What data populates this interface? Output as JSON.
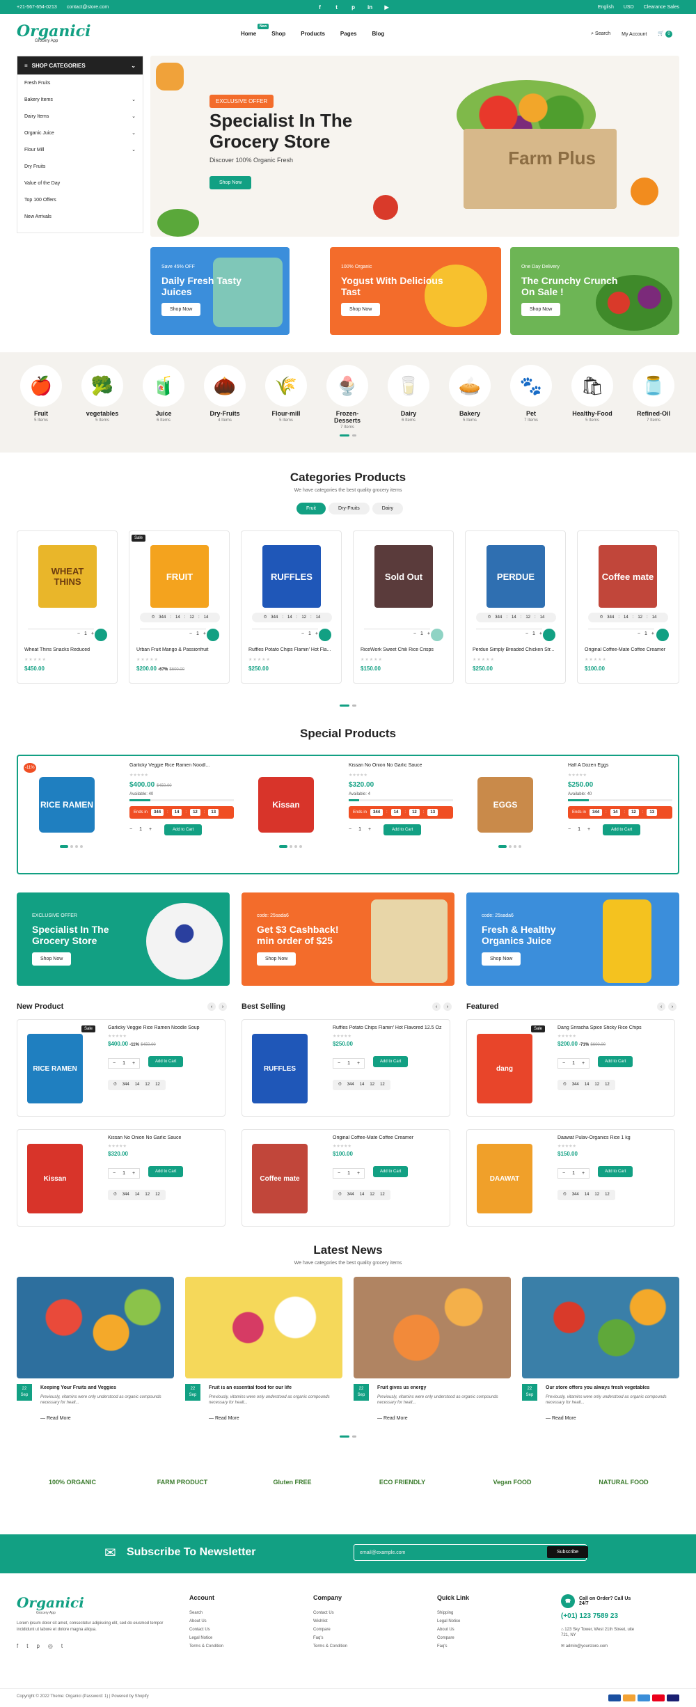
{
  "topbar": {
    "phone": "+21-567-654-0213",
    "email": "contact@store.com",
    "language": "English",
    "currency": "USD",
    "clearance": "Clearance Sales"
  },
  "header": {
    "logo": "Organici",
    "logo_sub": "Grocery App",
    "new_badge": "New",
    "search": "Search",
    "account": "My Account",
    "cart_count": "0"
  },
  "nav": [
    "Home",
    "Shop",
    "Products",
    "Pages",
    "Blog"
  ],
  "sidebar": {
    "title": "SHOP CATEGORIES",
    "items": [
      "Fresh Fruits",
      "Bakery Items",
      "Dairy Items",
      "Organic Juice",
      "Flour Mill",
      "Dry Fruits",
      "Value of the Day",
      "Top 100 Offers",
      "New Arrivals"
    ]
  },
  "hero": {
    "badge": "EXCLUSIVE OFFER",
    "title": "Specialist In The Grocery Store",
    "subtitle": "Discover 100% Organic Fresh",
    "button": "Shop Now",
    "crate": "Farm Plus"
  },
  "promos": [
    {
      "line1": "Save 45% OFF",
      "line2": "Daily Fresh Tasty Juices",
      "button": "Shop Now"
    },
    {
      "line1": "100% Organic",
      "line2": "Yogust With Delicious Tast",
      "button": "Shop Now"
    },
    {
      "line1": "One Day Delivery",
      "line2": "The Crunchy Crunch On Sale !",
      "button": "Shop Now"
    }
  ],
  "categories": [
    {
      "name": "Fruit",
      "count": "5 Items"
    },
    {
      "name": "vegetables",
      "count": "5 Items"
    },
    {
      "name": "Juice",
      "count": "6 Items"
    },
    {
      "name": "Dry-Fruits",
      "count": "4 Items"
    },
    {
      "name": "Flour-mill",
      "count": "5 Items"
    },
    {
      "name": "Frozen-Desserts",
      "count": "7 Items"
    },
    {
      "name": "Dairy",
      "count": "6 Items"
    },
    {
      "name": "Bakery",
      "count": "5 Items"
    },
    {
      "name": "Pet",
      "count": "7 Items"
    },
    {
      "name": "Healthy-Food",
      "count": "5 Items"
    },
    {
      "name": "Refined-Oil",
      "count": "7 Items"
    }
  ],
  "cat_products": {
    "title": "Categories Products",
    "subtitle": "We have categories the best quality grocery items",
    "tabs": [
      "Fruit",
      "Dry-Fruits",
      "Dairy"
    ],
    "items": [
      {
        "name": "Wheat Thins Snacks Reduced",
        "price": "$450.00",
        "old": "",
        "off": "",
        "img": "WHEAT THINS",
        "sale": ""
      },
      {
        "name": "Urban Fruit Mango & Passionfruit",
        "price": "$200.00",
        "old": "$600.00",
        "off": "-67%",
        "img": "FRUIT",
        "sale": "Sale"
      },
      {
        "name": "Ruffles Potato Chips Flamin' Hot Fla...",
        "price": "$250.00",
        "old": "",
        "off": "",
        "img": "RUFFLES",
        "sale": ""
      },
      {
        "name": "RiceWork Sweet Chili Rice Crisps",
        "price": "$150.00",
        "old": "",
        "off": "",
        "img": "Sold Out",
        "sale": ""
      },
      {
        "name": "Perdue Simply Breaded Chicken Str...",
        "price": "$250.00",
        "old": "",
        "off": "",
        "img": "PERDUE",
        "sale": ""
      },
      {
        "name": "Original Coffee-Mate Coffee Creamer",
        "price": "$100.00",
        "old": "",
        "off": "",
        "img": "Coffee mate",
        "sale": ""
      }
    ],
    "timer": [
      "344",
      "14",
      "12",
      "14"
    ]
  },
  "special": {
    "title": "Special Products",
    "items": [
      {
        "name": "Garlicky Veggie Rice Ramen Noodl...",
        "price": "$400.00",
        "old": "$450.00",
        "available": "Available: 40",
        "badge": "-11%",
        "img": "RICE RAMEN"
      },
      {
        "name": "Kissan No Onion No Garlic Sauce",
        "price": "$320.00",
        "old": "",
        "available": "Available: 4",
        "badge": "",
        "img": "Kissan"
      },
      {
        "name": "Half A Dozen Eggs",
        "price": "$250.00",
        "old": "",
        "available": "Available: 40",
        "badge": "",
        "img": "EGGS"
      }
    ],
    "ends": "Ends in",
    "timer": [
      "344",
      "14",
      "12",
      "13"
    ],
    "add": "Add to Cart",
    "qty": "1"
  },
  "banners": [
    {
      "line1": "EXCLUSIVE OFFER",
      "line2": "Specialist In The Grocery Store",
      "button": "Shop Now"
    },
    {
      "line1": "code: 25sada6",
      "line2": "Get $3 Cashback! min order of $25",
      "button": "Shop Now"
    },
    {
      "line1": "code: 25sada6",
      "line2": "Fresh & Healthy Organics Juice",
      "button": "Shop Now"
    }
  ],
  "columns": [
    {
      "title": "New Product",
      "items": [
        {
          "name": "Garlicky Veggie Rice Ramen Noodle Soup",
          "price": "$400.00",
          "old": "$450.00",
          "off": "-11%",
          "sale": "Sale",
          "img": "RICE RAMEN"
        },
        {
          "name": "Kissan No Onion No Garlic Sauce",
          "price": "$320.00",
          "old": "",
          "off": "",
          "sale": "",
          "img": "Kissan"
        }
      ]
    },
    {
      "title": "Best Selling",
      "items": [
        {
          "name": "Ruffles Potato Chips Flamin' Hot Flavored 12.5 Oz",
          "price": "$250.00",
          "old": "",
          "off": "",
          "sale": "",
          "img": "RUFFLES"
        },
        {
          "name": "Original Coffee-Mate Coffee Creamer",
          "price": "$100.00",
          "old": "",
          "off": "",
          "sale": "",
          "img": "Coffee mate"
        }
      ]
    },
    {
      "title": "Featured",
      "items": [
        {
          "name": "Dang Sriracha Spice Sticky Rice Chips",
          "price": "$200.00",
          "old": "$600.00",
          "off": "-71%",
          "sale": "Sale",
          "img": "dang"
        },
        {
          "name": "Daawat Pulav-Organics Rice 1 kg",
          "price": "$150.00",
          "old": "",
          "off": "",
          "sale": "",
          "img": "DAAWAT"
        }
      ]
    }
  ],
  "mini_timer": [
    "344",
    "14",
    "12",
    "12"
  ],
  "news": {
    "title": "Latest News",
    "subtitle": "We have categories the best quality grocery items",
    "items": [
      {
        "day": "22",
        "mon": "Sep",
        "title": "Keeping Your Fruits and Veggies",
        "text": "Previously, vitamins were only understood as organic compounds necessary for healt...",
        "more": "Read More"
      },
      {
        "day": "22",
        "mon": "Sep",
        "title": "Fruit is an essential food for our life",
        "text": "Previously, vitamins were only understood as organic compounds necessary for healt...",
        "more": "Read More"
      },
      {
        "day": "22",
        "mon": "Sep",
        "title": "Fruit gives us energy",
        "text": "Previously, vitamins were only understood as organic compounds necessary for healt...",
        "more": "Read More"
      },
      {
        "day": "22",
        "mon": "Sep",
        "title": "Our store offers you always fresh vegetables",
        "text": "Previously, vitamins were only understood as organic compounds necessary for healt...",
        "more": "Read More"
      }
    ]
  },
  "badges": [
    "100% ORGANIC",
    "FARM PRODUCT",
    "Gluten FREE",
    "ECO FRIENDLY",
    "Vegan FOOD",
    "NATURAL FOOD"
  ],
  "newsletter": {
    "title": "Subscribe To Newsletter",
    "placeholder": "email@example.com",
    "button": "Subscribe"
  },
  "footer": {
    "about": "Lorem ipsum dolor sit amet, consectetur adipiscing elit, sed do eiusmod tempor incididunt ut labore et dolore magna aliqua.",
    "account": {
      "title": "Account",
      "links": [
        "Search",
        "About Us",
        "Contact Us",
        "Legal Notice",
        "Terms & Condition"
      ]
    },
    "company": {
      "title": "Company",
      "links": [
        "Contact Us",
        "Wishlist",
        "Compare",
        "Faq's",
        "Terms & Condition"
      ]
    },
    "quick": {
      "title": "Quick Link",
      "links": [
        "Shipping",
        "Legal Notice",
        "About Us",
        "Compare",
        "Faq's"
      ]
    },
    "call": "Call on Order? Call Us 24/7",
    "phone": "(+01) 123 7589 23",
    "address": "123 Sky Tower, West 21th Street, uite 721, NY",
    "email": "admin@yourstore.com",
    "copy": "Copyright © 2022 Theme: Organici (Password: 1) | Powered by Shopify"
  },
  "colors": {
    "accent": "#12a083",
    "orange": "#f36c2b",
    "blue": "#3b8edb",
    "green": "#6db555",
    "red": "#f04e23"
  }
}
